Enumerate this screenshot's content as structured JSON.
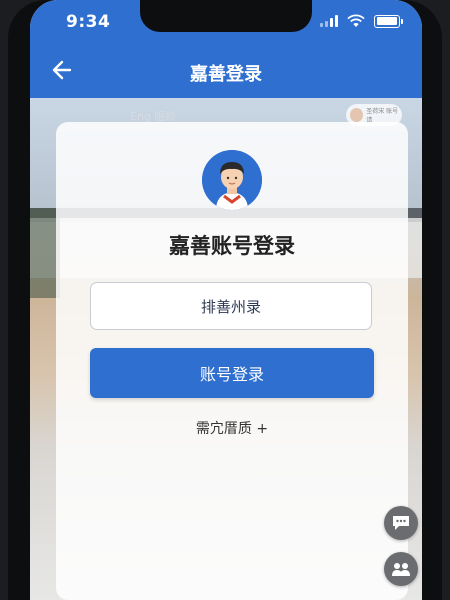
{
  "status_bar": {
    "time": "9:34"
  },
  "header": {
    "title": "嘉善登录"
  },
  "background": {
    "ghost_text": "Eng 眠岭",
    "chip_text": "圣荷宋 账号请"
  },
  "card": {
    "title": "嘉善账号登录",
    "account_input_value": "排善州录",
    "login_button_label": "账号登录",
    "more_link_label": "需宂厝质 +"
  },
  "colors": {
    "primary": "#2f6fd0",
    "card": "#ffffff",
    "float_button": "#6a6c70"
  },
  "icons": {
    "back": "arrow-left-icon",
    "chat": "chat-bubble-icon",
    "group": "group-icon"
  }
}
